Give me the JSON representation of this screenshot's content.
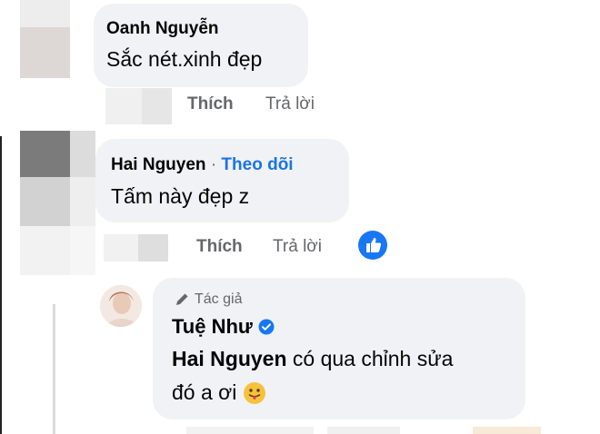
{
  "comments": [
    {
      "author": "Oanh Nguyễn",
      "text": "Sắc nét.xinh đẹp",
      "actions": {
        "like": "Thích",
        "reply": "Trả lời"
      }
    },
    {
      "author": "Hai Nguyen",
      "separator": "·",
      "follow": "Theo dõi",
      "text": "Tấm này đẹp z",
      "actions": {
        "like": "Thích",
        "reply": "Trả lời"
      }
    }
  ],
  "reply": {
    "badge": "Tác giả",
    "author": "Tuệ Như",
    "mention": "Hai Nguyen",
    "text_line1": " có qua chỉnh sửa",
    "text_line2": "đó a ơi "
  },
  "colors": {
    "bubble": "#f0f2f5",
    "link": "#1b74e4",
    "muted": "#65676b",
    "verified": "#1877f2"
  }
}
